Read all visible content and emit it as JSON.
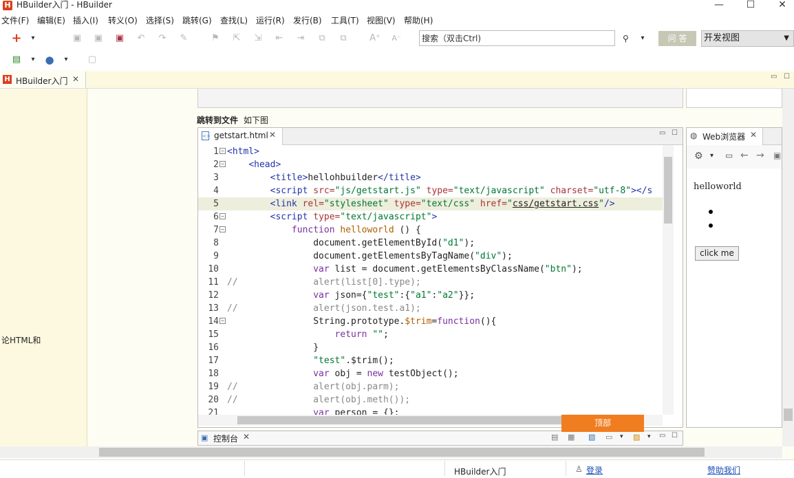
{
  "window": {
    "title": "HBuilder入门 - HBuilder",
    "app_icon": "H",
    "minimize": "—",
    "maximize": "☐",
    "close": "✕"
  },
  "menu": [
    "文件(F)",
    "编辑(E)",
    "插入(I)",
    "转义(O)",
    "选择(S)",
    "跳转(G)",
    "查找(L)",
    "运行(R)",
    "发行(B)",
    "工具(T)",
    "视图(V)",
    "帮助(H)"
  ],
  "toolbar": {
    "search_placeholder": "搜索（双击Ctrl)",
    "qa_button": "问 答",
    "view_select": "开发视图"
  },
  "tabs": {
    "main_tab": "HBuilder入门",
    "main_tab_icon": "H"
  },
  "doc": {
    "left_text": "论HTML和",
    "caption_bold": "跳转到文件",
    "caption": "如下图"
  },
  "editor": {
    "file_tab": "getstart.html",
    "lines": [
      {
        "n": "1",
        "fold": true,
        "parts": [
          [
            "tag",
            "<html>"
          ]
        ]
      },
      {
        "n": "2",
        "fold": true,
        "parts": [
          [
            "plain",
            "    "
          ],
          [
            "tag",
            "<head>"
          ]
        ]
      },
      {
        "n": "3",
        "fold": false,
        "parts": [
          [
            "plain",
            "        "
          ],
          [
            "tag",
            "<title>"
          ],
          [
            "plain",
            "hellohbuilder"
          ],
          [
            "tag",
            "</title>"
          ]
        ]
      },
      {
        "n": "4",
        "fold": false,
        "parts": [
          [
            "plain",
            "        "
          ],
          [
            "tag",
            "<script "
          ],
          [
            "attr",
            "src="
          ],
          [
            "str",
            "\"js/getstart.js\""
          ],
          [
            "attr",
            " type="
          ],
          [
            "str",
            "\"text/javascript\""
          ],
          [
            "attr",
            " charset="
          ],
          [
            "str",
            "\"utf-8\""
          ],
          [
            "tag",
            "></s"
          ]
        ]
      },
      {
        "n": "5",
        "fold": false,
        "hl": true,
        "parts": [
          [
            "plain",
            "        "
          ],
          [
            "tag",
            "<link "
          ],
          [
            "attr",
            "rel="
          ],
          [
            "str",
            "\"stylesheet\""
          ],
          [
            "attr",
            " type="
          ],
          [
            "str",
            "\"text/css\""
          ],
          [
            "attr",
            " href="
          ],
          [
            "str",
            "\""
          ],
          [
            "ul",
            "css/getstart.css"
          ],
          [
            "str",
            "\""
          ],
          [
            "tag",
            "/>"
          ]
        ]
      },
      {
        "n": "6",
        "fold": true,
        "parts": [
          [
            "plain",
            "        "
          ],
          [
            "tag",
            "<script "
          ],
          [
            "attr",
            "type="
          ],
          [
            "str",
            "\"text/javascript\""
          ],
          [
            "tag",
            ">"
          ]
        ]
      },
      {
        "n": "7",
        "fold": true,
        "parts": [
          [
            "plain",
            "            "
          ],
          [
            "kw",
            "function "
          ],
          [
            "fn",
            "helloworld "
          ],
          [
            "plain",
            "() {"
          ]
        ]
      },
      {
        "n": "8",
        "fold": false,
        "parts": [
          [
            "plain",
            "                document.getElementById("
          ],
          [
            "str",
            "\"d1\""
          ],
          [
            "plain",
            ");"
          ]
        ]
      },
      {
        "n": "9",
        "fold": false,
        "parts": [
          [
            "plain",
            "                document.getElementsByTagName("
          ],
          [
            "str",
            "\"div\""
          ],
          [
            "plain",
            ");"
          ]
        ]
      },
      {
        "n": "10",
        "fold": false,
        "parts": [
          [
            "plain",
            "                "
          ],
          [
            "kw",
            "var "
          ],
          [
            "plain",
            "list = document.getElementsByClassName("
          ],
          [
            "str",
            "\"btn\""
          ],
          [
            "plain",
            ");"
          ]
        ]
      },
      {
        "n": "11",
        "fold": false,
        "parts": [
          [
            "cm",
            "//              alert(list[0].type);"
          ]
        ]
      },
      {
        "n": "12",
        "fold": false,
        "parts": [
          [
            "plain",
            "                "
          ],
          [
            "kw",
            "var "
          ],
          [
            "plain",
            "json={"
          ],
          [
            "str",
            "\"test\""
          ],
          [
            "plain",
            ":{"
          ],
          [
            "str",
            "\"a1\""
          ],
          [
            "plain",
            ":"
          ],
          [
            "str",
            "\"a2\""
          ],
          [
            "plain",
            "}};"
          ]
        ]
      },
      {
        "n": "13",
        "fold": false,
        "parts": [
          [
            "cm",
            "//              alert(json.test.a1);"
          ]
        ]
      },
      {
        "n": "14",
        "fold": true,
        "parts": [
          [
            "plain",
            "                String.prototype."
          ],
          [
            "fn",
            "$trim"
          ],
          [
            "plain",
            "="
          ],
          [
            "kw",
            "function"
          ],
          [
            "plain",
            "(){"
          ]
        ]
      },
      {
        "n": "15",
        "fold": false,
        "parts": [
          [
            "plain",
            "                    "
          ],
          [
            "kw",
            "return "
          ],
          [
            "str",
            "\"\""
          ],
          [
            "plain",
            ";"
          ]
        ]
      },
      {
        "n": "16",
        "fold": false,
        "parts": [
          [
            "plain",
            "                }"
          ]
        ]
      },
      {
        "n": "17",
        "fold": false,
        "parts": [
          [
            "plain",
            "                "
          ],
          [
            "str",
            "\"test\""
          ],
          [
            "plain",
            ".$trim();"
          ]
        ]
      },
      {
        "n": "18",
        "fold": false,
        "parts": [
          [
            "plain",
            "                "
          ],
          [
            "kw",
            "var "
          ],
          [
            "plain",
            "obj = "
          ],
          [
            "kw",
            "new "
          ],
          [
            "plain",
            "testObject();"
          ]
        ]
      },
      {
        "n": "19",
        "fold": false,
        "parts": [
          [
            "cm",
            "//              alert(obj.parm);"
          ]
        ]
      },
      {
        "n": "20",
        "fold": false,
        "parts": [
          [
            "cm",
            "//              alert(obj.meth());"
          ]
        ]
      },
      {
        "n": "21",
        "fold": false,
        "parts": [
          [
            "plain",
            "                "
          ],
          [
            "kw",
            "var "
          ],
          [
            "plain",
            "person = {};"
          ]
        ]
      }
    ]
  },
  "browser": {
    "tab": "Web浏览器",
    "helloworld": "helloworld",
    "button": "click me"
  },
  "console": {
    "label": "控制台"
  },
  "top_button": "顶部",
  "status": {
    "tab": "HBuilder入门",
    "login": "登录",
    "sponsor": "赞助我们"
  },
  "icons": {
    "add": "+",
    "dropdown": "▾",
    "search": "🔍",
    "close_tab": "✕",
    "min": "▭",
    "max": "☐",
    "globe": "◍",
    "gear": "⚙",
    "back": "←",
    "forward": "→",
    "user": "👤",
    "console": "🖵"
  }
}
